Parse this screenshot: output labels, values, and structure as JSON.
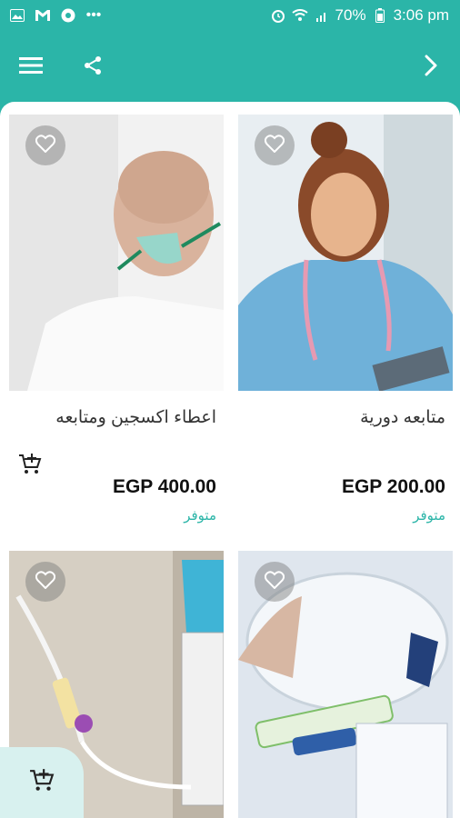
{
  "status_bar": {
    "battery": "70%",
    "time": "3:06 pm",
    "icons": [
      "gallery-icon",
      "gmail-icon",
      "chrome-icon",
      "more-icon",
      "alarm-icon",
      "wifi-icon",
      "signal-icon",
      "battery-icon"
    ]
  },
  "app_bar": {
    "icons": [
      "menu-icon",
      "share-icon",
      "chevron-right-icon"
    ]
  },
  "products": [
    {
      "title": "متابعه دورية",
      "price": "EGP 200.00",
      "availability": "متوفر",
      "image": "nurse-with-stethoscope"
    },
    {
      "title": "اعطاء اكسجين ومتابعه",
      "price": "EGP 400.00",
      "availability": "متوفر",
      "image": "patient-oxygen-mask"
    },
    {
      "title": "",
      "price": "",
      "availability": "",
      "image": "iv-catheter-kit"
    },
    {
      "title": "",
      "price": "",
      "availability": "",
      "image": "iv-infusion-set"
    }
  ],
  "colors": {
    "primary": "#2bb5a8",
    "fab_bg": "#d8f1ef"
  }
}
